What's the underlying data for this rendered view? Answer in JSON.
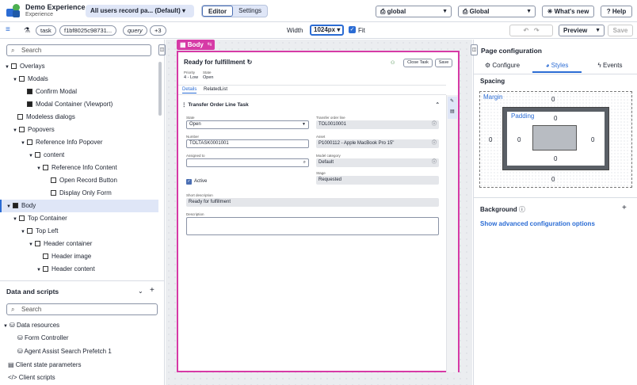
{
  "header": {
    "app_title": "Demo Experience",
    "app_subtitle": "Experience",
    "variant": "All users record pa... (Default)",
    "mode_editor": "Editor",
    "mode_settings": "Settings",
    "scope": "global",
    "scope2": "Global",
    "whats_new": "What's new",
    "help": "Help"
  },
  "toolbar": {
    "menu_icon": "≡",
    "task_chip": "task",
    "sys_id_chip": "f1bf8025c98731...",
    "query_chip": "query",
    "more_chip": "+3",
    "width_label": "Width",
    "width_value": "1024px",
    "fit_label": "Fit",
    "preview": "Preview",
    "save": "Save"
  },
  "left": {
    "search_placeholder": "Search",
    "tree": [
      "Overlays",
      "Modals",
      "Confirm Modal",
      "Modal Container (Viewport)",
      "Modeless dialogs",
      "Popovers",
      "Reference Info Popover",
      "content",
      "Reference Info Content",
      "Open Record Button",
      "Display Only Form",
      "Body",
      "Top Container",
      "Top Left",
      "Header container",
      "Header image",
      "Header content"
    ],
    "data_title": "Data and scripts",
    "data_search": "Search",
    "data_items": [
      "Data resources",
      "Form Controller",
      "Agent Assist Search Prefetch 1",
      "Client state parameters",
      "Client scripts"
    ]
  },
  "canvas": {
    "body_tag": "Body",
    "record_title": "Ready for fulfillment",
    "close_task": "Close Task",
    "save": "Save",
    "priority_label": "Priority",
    "priority_value": "4 - Low",
    "state_label": "State",
    "state_value": "Open",
    "tab_details": "Details",
    "tab_related": "RelatedList",
    "section_title": "Transfer Order Line Task",
    "f_state_label": "State",
    "f_state_value": "Open",
    "f_tol_label": "Transfer order line",
    "f_tol_value": "TOL0010001",
    "f_number_label": "Number",
    "f_number_value": "TOLTASK0001001",
    "f_asset_label": "Asset",
    "f_asset_value": "P1000112 - Apple MacBook Pro 15\"",
    "f_assigned_label": "Assigned to",
    "f_model_label": "Model category",
    "f_model_value": "Default",
    "f_active_label": "Active",
    "f_stage_label": "Stage",
    "f_stage_value": "Requested",
    "f_short_label": "Short description",
    "f_short_value": "Ready for fulfillment",
    "f_desc_label": "Description"
  },
  "right": {
    "title": "Page configuration",
    "tab_configure": "Configure",
    "tab_styles": "Styles",
    "tab_events": "Events",
    "spacing": "Spacing",
    "margin": "Margin",
    "padding": "Padding",
    "m_top": "0",
    "m_right": "0",
    "m_bottom": "0",
    "m_left": "0",
    "p_top": "0",
    "p_right": "0",
    "p_bottom": "0",
    "p_left": "0",
    "background": "Background",
    "advanced": "Show advanced configuration options"
  },
  "colors": {
    "accent": "#2b6cd4",
    "selection": "#d63aa6"
  }
}
